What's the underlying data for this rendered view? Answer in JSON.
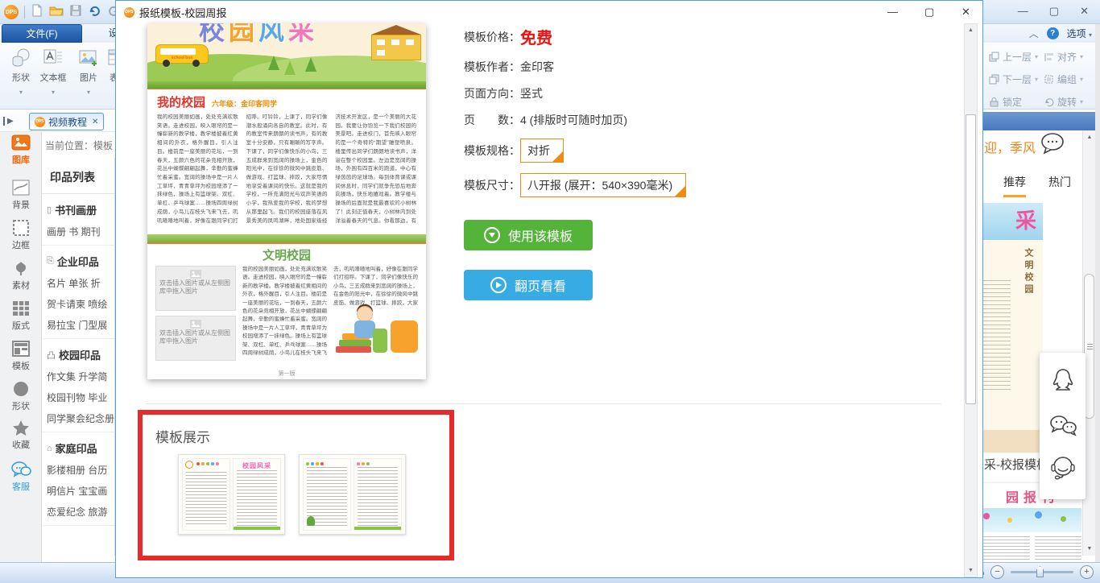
{
  "glyphs": {
    "dropdown": "▾",
    "minimize": "—",
    "maximize": "▢",
    "close": "✕",
    "scroll_up": "▲",
    "scroll_down": "▼",
    "expand_right": "▶",
    "collapse": "︿",
    "help": "?",
    "plus": "+",
    "minus": "−"
  },
  "quick_access": {
    "logo": "DPS"
  },
  "menu_tabs": {
    "file": "文件(F)",
    "design": "设计(D)"
  },
  "ribbon": {
    "tools": [
      {
        "label": "形状"
      },
      {
        "label": "文本框"
      },
      {
        "label": "图片"
      },
      {
        "label": "表格"
      }
    ],
    "right_rows": [
      {
        "label": "上一层"
      },
      {
        "label": "对齐"
      },
      {
        "label": "下一层"
      },
      {
        "label": "编组"
      },
      {
        "label": "锁定"
      },
      {
        "label": "旋转"
      }
    ],
    "options_label": "选项"
  },
  "video_tab": {
    "label": "视频教程"
  },
  "current_location": "当前位置：模板",
  "sidebar": {
    "items": [
      {
        "label": "图库"
      },
      {
        "label": "背景"
      },
      {
        "label": "边框"
      },
      {
        "label": "素材"
      },
      {
        "label": "版式"
      },
      {
        "label": "模板"
      },
      {
        "label": "形状"
      },
      {
        "label": "收藏"
      },
      {
        "label": "客服"
      }
    ]
  },
  "print_list": {
    "title": "印品列表",
    "sections": [
      {
        "heading": "书刊画册",
        "icon": "▯",
        "lines": [
          "画册 书 期刊"
        ]
      },
      {
        "heading": "企业印品",
        "icon": "⎘",
        "lines": [
          "名片 单张 折",
          "贺卡请柬 喷绘",
          "易拉宝 门型展"
        ]
      },
      {
        "heading": "校园印品",
        "icon": "凸",
        "lines": [
          "作文集 升学简",
          "校园刊物 毕业",
          "同学聚会纪念册"
        ]
      },
      {
        "heading": "家庭印品",
        "icon": "⌂",
        "lines": [
          "影楼相册 台历",
          "明信片 宝宝画",
          "恋爱纪念 旅游"
        ]
      }
    ]
  },
  "dialog": {
    "title": "报纸模板-校园周报",
    "details": {
      "price_label": "模板价格：",
      "price_value": "免费",
      "author_label": "模板作者：",
      "author_value": "金印客",
      "orientation_label": "页面方向：",
      "orientation_value": "竖式",
      "pages_label": "页　　数：",
      "pages_value": "4 (排版时可随时加页)",
      "spec_label": "模板规格：",
      "spec_value": "对折",
      "size_label": "模板尺寸：",
      "size_value": "八开报 (展开：540×390毫米)"
    },
    "use_button": "使用该模板",
    "flip_button": "翻页看看",
    "display_title": "模板展示",
    "thumb1_title": "校园风采"
  },
  "preview": {
    "masthead_chars": [
      "校",
      "园",
      "风",
      "采"
    ],
    "bus_text": "school bus",
    "article1_title": "我的校园",
    "article1_byline": "六年级：金印客同学",
    "article1_text": "我的校园美丽如画，处处充满欢歌笑语。走进校园，映入眼帘的是一幢崭新的教学楼，教学楼披着红黄相间的外衣，格外醒目，引人注目。楼前是一座美丽的花坛，一到春天，五颜六色的花朵竞相开放，花丛中蝴蝶翩翩起舞，辛勤的蜜蜂忙着采蜜。宽阔的操场中是一片人工草坪，青青草坪为校园增添了一抹绿色，操场上有篮球架、双杠、单杠、乒乓球案……操场四周绿树成荫，小鸟儿在枝头飞来飞去，叽叽喳喳地叫着，好像在跟同学们打招呼。叮铃铃，上课了，同学们像潮水般涌向各自的教室。此时，有的教室传来朗朗的读书声，有的教室十分安静，只有唰唰的写字声。下课了，同学们像快乐的小鸟，三五成群来到宽阔的操场上，金色的阳光中，在徐徐的微风中跳皮筋、做游戏、打篮球、摔跤，大家尽情地享受着课间的快乐。这就是我的学校，一所充满阳光与欢声笑语的小学，我热爱我的学校，我的梦想从那里起飞。我们的校园座落在风景秀美的凤鸣湖畔，地处国家级经济技术开发区，是一个美丽的大花园。我要让你饱览一下我们校园的美景吧。走进校门，首先映入眼帘的是一个奇特的“期望”雕塑喷泉。楼里传出同学们朗朗地读书声，洋溢在整个校园里。左边是宽阔的操场，外围有四百米的跑道，中心有绿茵茵的足球场。每到体育课或课间休息时，同学们就争先恐后地奔向操场，快乐地嬉戏着。教学楼与操场的后面就是我最喜欢的小树林了！此刻正值春天，小树林内到处洋溢着春天的气息。你看那边，有一棵白玉兰。白玉兰树斜斜的伸展着枝干，无叶无绿，只是一朵朵白的有些清透的花朵在春阳下朵朵优雅宁静地绽放。一片片洁白如玉的花瓣，一丝丝星星点点的花蕊，一个个灰色的花柄，组成了一朵朵洁白芬芳的玉兰，是如此的轻盈而又完美。",
    "article2_title": "文明校园",
    "article2_text": "我的校园美丽如画，处处充满欢歌笑语。走进校园，映入眼帘的是一幢崭新的教学楼。教学楼披着红黄相间的外衣，格外醒目，引人注目。楼前是一座美丽的花坛，一到春天，五颜六色的花朵竞相开放，花丛中蝴蝶翩翩起舞，辛勤的蜜蜂忙着采蜜。宽阔的操场中是一片人工草坪，青青草坪为校园增添了一抹绿色。操场上有篮球架、双杠、单杠、乒乓球案……操场四周绿树成荫，小鸟儿在枝头飞来飞去，叽叽喳喳地叫着，好像在跟同学们打招呼。下课了，同学们像快乐的小鸟，三五成群来到宽阔的操场上，在金色的阳光中，在徐徐的微风中跳皮筋、做游戏、打篮球、摔跤，大家尽情地享受着课间的快乐。这就是我的学校，一所充满阳光与欢声笑语的小学，我热爱我的学校，我的梦想从那里起飞。我们的校园座落在风景秀美的凤鸣湖畔，地处国家级经济技术开发区，是一个美丽的大花园。我要让你饱览一下我们校园的美景吧。",
    "placeholder_text": "双击插入图片或从左侧图库中拖入图片",
    "footer": "第一版"
  },
  "right_panel": {
    "user_text": "迎，季风",
    "tabs": [
      {
        "label": "推荐"
      },
      {
        "label": "热门"
      }
    ],
    "thumb_partial_char": "采",
    "thumb_vertical_title": "文明校园",
    "caption1": "采-校报模板",
    "caption2": "园报刊"
  },
  "status_bar": {
    "percent": "%"
  }
}
